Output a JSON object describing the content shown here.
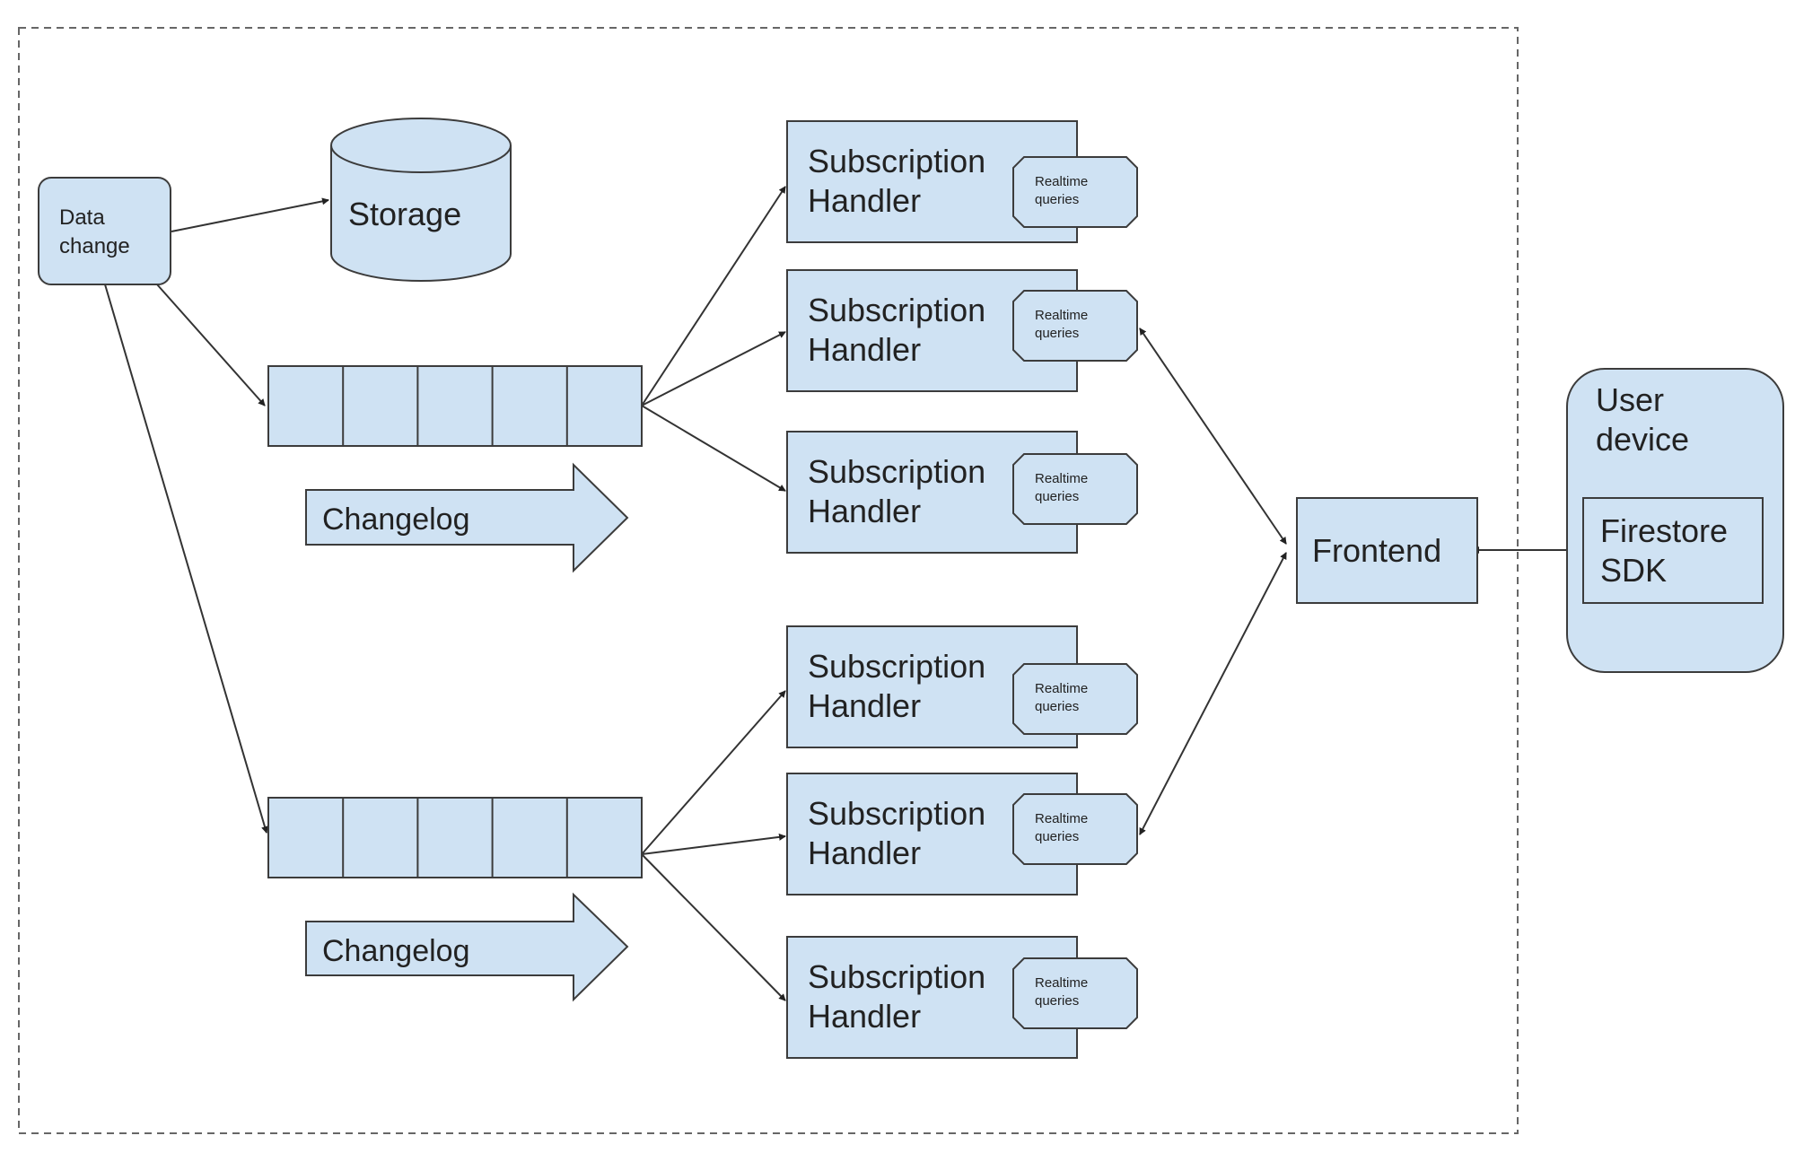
{
  "colors": {
    "fill": "#cfe2f3",
    "stroke": "#3c3c3c",
    "line": "#333333",
    "boundary": "#666666"
  },
  "nodes": {
    "data_change": {
      "lines": [
        "Data",
        "change"
      ]
    },
    "storage": {
      "label": "Storage"
    },
    "changelog_1": {
      "label": "Changelog",
      "cells": 5
    },
    "changelog_2": {
      "label": "Changelog",
      "cells": 5
    },
    "handlers": [
      {
        "lines": [
          "Subscription",
          "Handler"
        ],
        "sub": [
          "Realtime",
          "queries"
        ]
      },
      {
        "lines": [
          "Subscription",
          "Handler"
        ],
        "sub": [
          "Realtime",
          "queries"
        ]
      },
      {
        "lines": [
          "Subscription",
          "Handler"
        ],
        "sub": [
          "Realtime",
          "queries"
        ]
      },
      {
        "lines": [
          "Subscription",
          "Handler"
        ],
        "sub": [
          "Realtime",
          "queries"
        ]
      },
      {
        "lines": [
          "Subscription",
          "Handler"
        ],
        "sub": [
          "Realtime",
          "queries"
        ]
      },
      {
        "lines": [
          "Subscription",
          "Handler"
        ],
        "sub": [
          "Realtime",
          "queries"
        ]
      }
    ],
    "frontend": {
      "label": "Frontend"
    },
    "user_device": {
      "lines": [
        "User",
        "device"
      ]
    },
    "firestore_sdk": {
      "lines": [
        "Firestore",
        "SDK"
      ]
    }
  },
  "edges": [
    {
      "from": "data_change",
      "to": "storage",
      "direction": "forward"
    },
    {
      "from": "data_change",
      "to": "changelog_1",
      "direction": "forward"
    },
    {
      "from": "data_change",
      "to": "changelog_2",
      "direction": "forward"
    },
    {
      "from": "changelog_1",
      "to": "handler_1",
      "direction": "forward"
    },
    {
      "from": "changelog_1",
      "to": "handler_2",
      "direction": "forward"
    },
    {
      "from": "changelog_1",
      "to": "handler_3",
      "direction": "forward"
    },
    {
      "from": "changelog_2",
      "to": "handler_4",
      "direction": "forward"
    },
    {
      "from": "changelog_2",
      "to": "handler_5",
      "direction": "forward"
    },
    {
      "from": "changelog_2",
      "to": "handler_6",
      "direction": "forward"
    },
    {
      "from": "handler_2",
      "to": "frontend",
      "direction": "both"
    },
    {
      "from": "handler_5",
      "to": "frontend",
      "direction": "both"
    },
    {
      "from": "frontend",
      "to": "firestore_sdk",
      "direction": "both"
    }
  ]
}
